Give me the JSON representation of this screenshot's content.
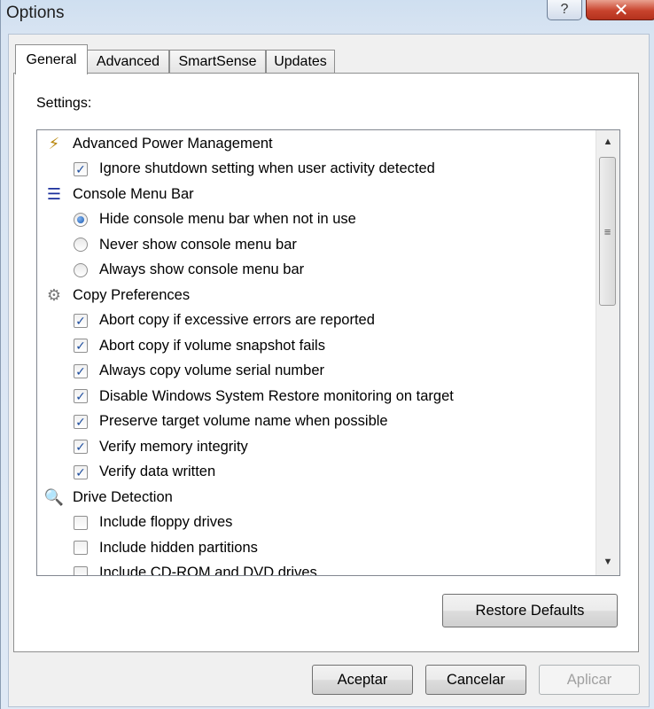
{
  "window": {
    "title": "Options",
    "help_glyph": "?",
    "close_glyph": "✕"
  },
  "tabs": [
    {
      "label": "General",
      "active": true
    },
    {
      "label": "Advanced",
      "active": false
    },
    {
      "label": "SmartSense",
      "active": false
    },
    {
      "label": "Updates",
      "active": false
    }
  ],
  "settings_label": "Settings:",
  "sections": [
    {
      "title": "Advanced Power Management",
      "icon": "power-management-icon",
      "items": [
        {
          "type": "checkbox",
          "checked": true,
          "label": "Ignore shutdown setting when user activity detected"
        }
      ]
    },
    {
      "title": "Console Menu Bar",
      "icon": "menu-bar-icon",
      "items": [
        {
          "type": "radio",
          "checked": true,
          "label": "Hide console menu bar when not in use"
        },
        {
          "type": "radio",
          "checked": false,
          "label": "Never show console menu bar"
        },
        {
          "type": "radio",
          "checked": false,
          "label": "Always show console menu bar"
        }
      ]
    },
    {
      "title": "Copy Preferences",
      "icon": "gear-icon",
      "items": [
        {
          "type": "checkbox",
          "checked": true,
          "label": "Abort copy if excessive errors are reported"
        },
        {
          "type": "checkbox",
          "checked": true,
          "label": "Abort copy if volume snapshot fails"
        },
        {
          "type": "checkbox",
          "checked": true,
          "label": "Always copy volume serial number"
        },
        {
          "type": "checkbox",
          "checked": true,
          "label": "Disable Windows System Restore monitoring on target"
        },
        {
          "type": "checkbox",
          "checked": true,
          "label": "Preserve target volume name when possible"
        },
        {
          "type": "checkbox",
          "checked": true,
          "label": "Verify memory integrity"
        },
        {
          "type": "checkbox",
          "checked": true,
          "label": "Verify data written"
        }
      ]
    },
    {
      "title": "Drive Detection",
      "icon": "magnifier-icon",
      "items": [
        {
          "type": "checkbox",
          "checked": false,
          "label": "Include floppy drives"
        },
        {
          "type": "checkbox",
          "checked": false,
          "label": "Include hidden partitions"
        },
        {
          "type": "checkbox",
          "checked": false,
          "label": "Include CD-ROM and DVD drives"
        }
      ]
    }
  ],
  "scrollbar": {
    "up_glyph": "▲",
    "down_glyph": "▼",
    "grip_glyph": "≡"
  },
  "buttons": {
    "restore_defaults": "Restore Defaults",
    "accept": "Aceptar",
    "cancel": "Cancelar",
    "apply": "Aplicar"
  }
}
